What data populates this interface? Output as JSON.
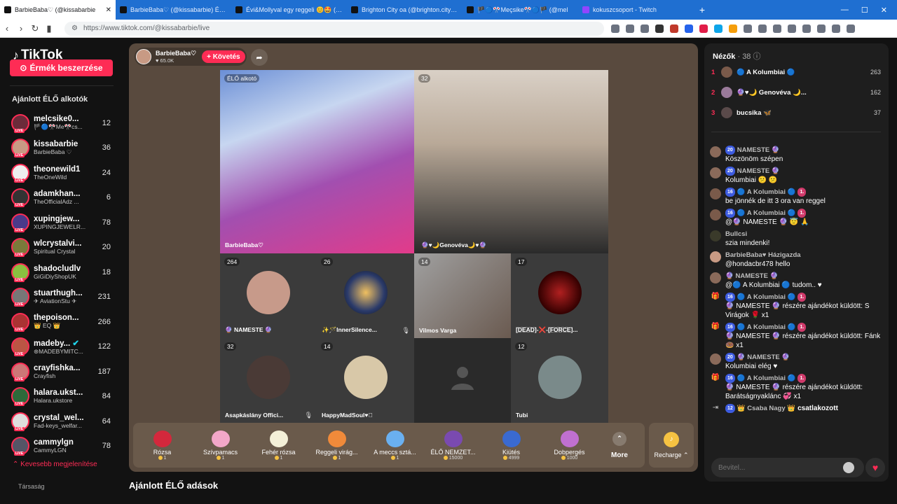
{
  "browser": {
    "tabs": [
      {
        "title": "BarbieBaba♡ (@kissabarbie",
        "active": true
      },
      {
        "title": "BarbieBaba♡ (@kissabarbie) ÉLŐ",
        "active": false
      },
      {
        "title": "Évi&Mollyval egy reggeli 😊🤩 (@m",
        "active": false
      },
      {
        "title": "Brighton City oa (@brighton.city) ÉLŐ",
        "active": false
      },
      {
        "title": "🏴🔵🎌Meçsike🎌🔵🏴 (@mel",
        "active": false
      },
      {
        "title": "kokuszcsoport - Twitch",
        "active": false
      }
    ],
    "url": "https://www.tiktok.com/@kissabarbie/live"
  },
  "sidebar": {
    "logo": "TikTok",
    "coins_button": "Érmék beszerzése",
    "section_title": "Ajánlott ÉLŐ alkotók",
    "creators": [
      {
        "name": "melcsike0...",
        "sub": "🏴🔵🎌Me🎌cs...",
        "count": "12"
      },
      {
        "name": "kissabarbie",
        "sub": "BarbieBaba ♡",
        "count": "36"
      },
      {
        "name": "theonewild1",
        "sub": "TheOneWild",
        "count": "24"
      },
      {
        "name": "adamkhan...",
        "sub": "TheOfficialAdz ...",
        "count": "6"
      },
      {
        "name": "xupingjew...",
        "sub": "XUPINGJEWELR...",
        "count": "78"
      },
      {
        "name": "wlcrystalvi...",
        "sub": "Spiritual Crystal",
        "count": "20"
      },
      {
        "name": "shadocludlv",
        "sub": "GiGiDiyShopUK",
        "count": "18"
      },
      {
        "name": "stuarthugh...",
        "sub": "✈ AviationStu ✈",
        "count": "231"
      },
      {
        "name": "thepoison...",
        "sub": "👑 EQ 👑",
        "count": "266"
      },
      {
        "name": "madeby...",
        "sub": "⊛MADEBYMITC...",
        "count": "122"
      },
      {
        "name": "crayfishka...",
        "sub": "Crayfish",
        "count": "187"
      },
      {
        "name": "halara.ukst...",
        "sub": "Halara.ukstore",
        "count": "84"
      },
      {
        "name": "crystal_wel...",
        "sub": "Fad-keys_welfar...",
        "count": "64"
      },
      {
        "name": "cammylgn",
        "sub": "CammyLGN",
        "count": "78"
      }
    ],
    "show_less": "Kevesebb megjelenítése",
    "friends": "Társaság"
  },
  "stage": {
    "host_name": "BarbieBaba♡",
    "host_likes": "♥ 65.0K",
    "follow_label": "+ Követés",
    "cells": [
      {
        "badge": "ÉLŐ alkotó",
        "name": "BarbieBaba♡"
      },
      {
        "badge": "32",
        "name": "🔮♥🌙Genovéva🌙♥🔮"
      },
      {
        "badge": "264",
        "name": "🔮 NAMESTE 🔮"
      },
      {
        "badge": "26",
        "name": "✨🪄InnerSilence..."
      },
      {
        "badge": "14",
        "name": "Vilmos Varga"
      },
      {
        "badge": "17",
        "name": "[̲̅D̲̅E̲̅A̲̅D̲̅]-❌-[̲̅F̲̅O̲̅R̲̅C̲̅E̲̅]..."
      },
      {
        "badge": "32",
        "name": "Asapkáslány Offici..."
      },
      {
        "badge": "14",
        "name": "HappyMadSoul♥⃝"
      },
      {
        "badge": "",
        "name": ""
      },
      {
        "badge": "12",
        "name": "Tubi"
      }
    ],
    "gifts": [
      {
        "name": "Rózsa",
        "price": "1"
      },
      {
        "name": "Szívpamacs",
        "price": "1"
      },
      {
        "name": "Fehér rózsa",
        "price": "1"
      },
      {
        "name": "Reggeli virág...",
        "price": "1"
      },
      {
        "name": "A meccs sztá...",
        "price": "1"
      },
      {
        "name": "ÉLŐ NEMZET...",
        "price": "15000"
      },
      {
        "name": "Kiütés",
        "price": "4999"
      },
      {
        "name": "Dobpergés",
        "price": "1000"
      }
    ],
    "more_label": "More",
    "recharge_label": "Recharge ⌃"
  },
  "recommended_title": "Ajánlott ÉLŐ adások",
  "chat": {
    "viewers_label": "Nézők",
    "viewers_count": "· 38",
    "ranking": [
      {
        "rank": "1",
        "name": "🔵 A Kolumbiai 🔵",
        "points": "263"
      },
      {
        "rank": "2",
        "name": "🔮♥🌙 Genovéva 🌙...",
        "points": "162"
      },
      {
        "rank": "3",
        "name": "bucsika 🦋",
        "points": "37"
      }
    ],
    "messages": [
      {
        "user": "NAMESTE 🔮",
        "badge": "20",
        "text": "Köszönöm szépen"
      },
      {
        "user": "NAMESTE 🔮",
        "badge": "20",
        "text": "Kolumbiai 😕 😕"
      },
      {
        "user": "🔵 A Kolumbiai 🔵",
        "badge": "16",
        "text": "be jönnék de itt 3 ora van reggel"
      },
      {
        "user": "🔵 A Kolumbiai 🔵",
        "badge": "16",
        "text": "@🔮 NAMESTE 🔮 😇 🙏"
      },
      {
        "user": "Bullcsi",
        "badge": "",
        "text": "szia mindenki!"
      },
      {
        "user": "BarbieBaba♥ Házigazda",
        "badge": "",
        "text": "@hondacbr478 hello"
      },
      {
        "user": "🔮 NAMESTE 🔮",
        "badge": "",
        "text": "@🔵 A Kolumbiai 🔵 tudom.. ♥"
      },
      {
        "user": "🔵 A Kolumbiai 🔵",
        "badge": "16",
        "text": "🔮 NAMESTE 🔮 részére ajándékot küldött: S Virágok 🌹 x1"
      },
      {
        "user": "🔵 A Kolumbiai 🔵",
        "badge": "16",
        "text": "🔮 NAMESTE 🔮 részére ajándékot küldött: Fánk 🍩 x1"
      },
      {
        "user": "🔮 NAMESTE 🔮",
        "badge": "20",
        "text": "Kolumbiai elég ♥"
      },
      {
        "user": "🔵 A Kolumbiai 🔵",
        "badge": "16",
        "text": "🔮 NAMESTE 🔮 részére ajándékot küldött: Barátságnyaklánc 💞 x1"
      },
      {
        "user": "👑 Csaba Nagy 👑",
        "badge": "12",
        "text": "csatlakozott"
      }
    ],
    "input_placeholder": "Bevitel..."
  }
}
